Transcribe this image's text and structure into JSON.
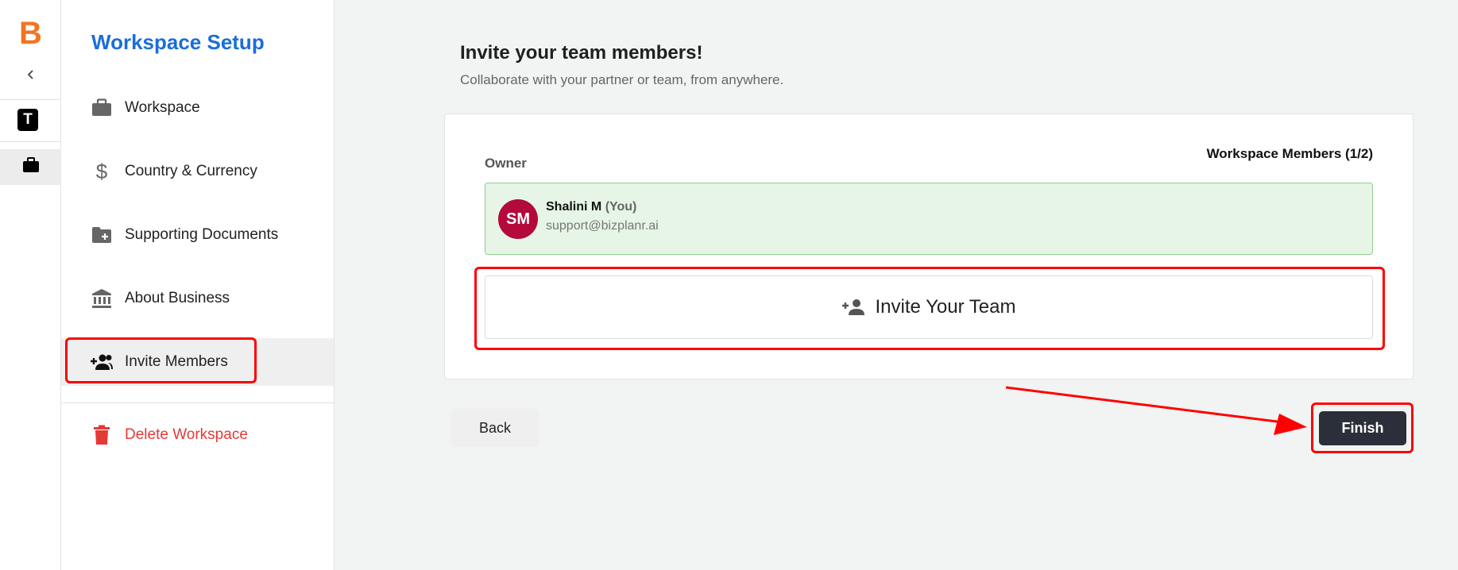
{
  "app": {
    "logo_letter": "B",
    "workspace_initial": "T"
  },
  "sidebar": {
    "title": "Workspace Setup",
    "items": [
      {
        "label": "Workspace",
        "icon": "briefcase-icon"
      },
      {
        "label": "Country & Currency",
        "icon": "dollar-icon"
      },
      {
        "label": "Supporting Documents",
        "icon": "folder-add-icon"
      },
      {
        "label": "About Business",
        "icon": "bank-icon"
      },
      {
        "label": "Invite Members",
        "icon": "group-add-icon",
        "active": true
      },
      {
        "label": "Delete Workspace",
        "icon": "trash-icon",
        "danger": true
      }
    ]
  },
  "main": {
    "title": "Invite your team members!",
    "subtitle": "Collaborate with your partner or team, from anywhere.",
    "owner_label": "Owner",
    "members_count": "Workspace Members (1/2)",
    "owner": {
      "initials": "SM",
      "name": "Shalini M",
      "you_tag": "(You)",
      "email": "support@bizplanr.ai",
      "avatar_color": "#b3093b"
    },
    "invite_label": "Invite Your Team",
    "back_label": "Back",
    "finish_label": "Finish"
  },
  "colors": {
    "brand": "#f47321",
    "title_blue": "#1a6ddb",
    "danger": "#e53935",
    "finish_bg": "#2b2f3a",
    "annotation_red": "#ff0000"
  }
}
